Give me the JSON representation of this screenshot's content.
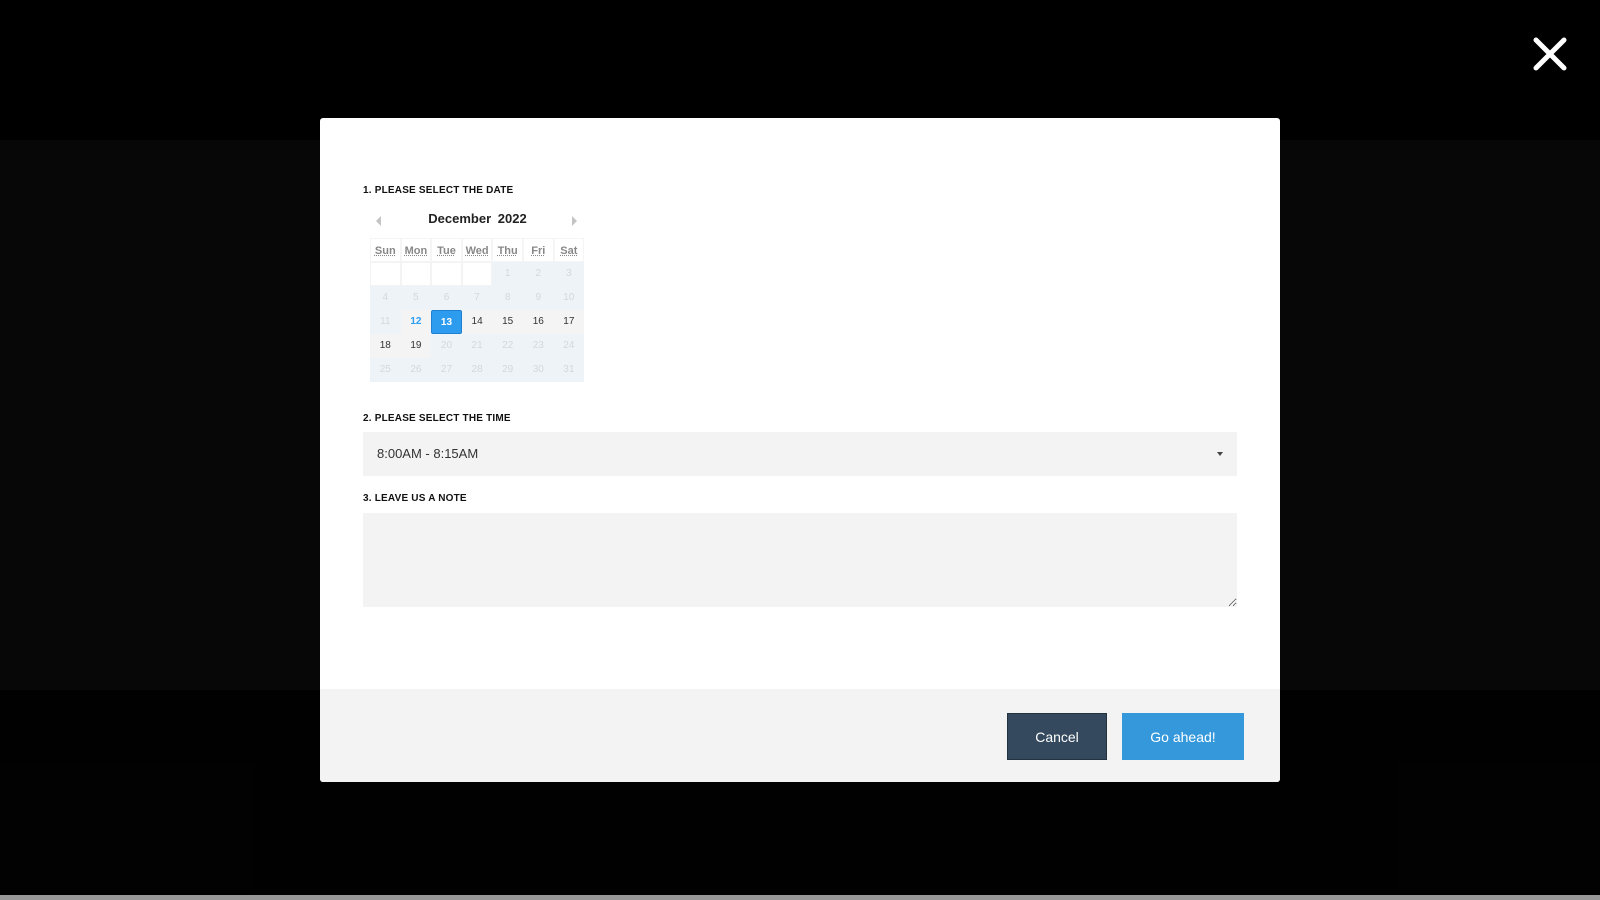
{
  "close": {
    "icon": "close-icon",
    "label": "Close"
  },
  "modal": {
    "date_section": {
      "label": "1. Please select the date",
      "calendar": {
        "month": "December",
        "year": "2022",
        "prev_icon": "chevron-left-icon",
        "next_icon": "chevron-right-icon",
        "weekdays": [
          "Sun",
          "Mon",
          "Tue",
          "Wed",
          "Thu",
          "Fri",
          "Sat"
        ],
        "leading_empty_days": 4,
        "days": [
          {
            "d": "1",
            "state": "disabled"
          },
          {
            "d": "2",
            "state": "disabled"
          },
          {
            "d": "3",
            "state": "disabled"
          },
          {
            "d": "4",
            "state": "disabled"
          },
          {
            "d": "5",
            "state": "disabled"
          },
          {
            "d": "6",
            "state": "disabled"
          },
          {
            "d": "7",
            "state": "disabled"
          },
          {
            "d": "8",
            "state": "disabled"
          },
          {
            "d": "9",
            "state": "disabled"
          },
          {
            "d": "10",
            "state": "disabled"
          },
          {
            "d": "11",
            "state": "disabled"
          },
          {
            "d": "12",
            "state": "today"
          },
          {
            "d": "13",
            "state": "selected"
          },
          {
            "d": "14",
            "state": "available"
          },
          {
            "d": "15",
            "state": "available"
          },
          {
            "d": "16",
            "state": "available"
          },
          {
            "d": "17",
            "state": "available"
          },
          {
            "d": "18",
            "state": "available"
          },
          {
            "d": "19",
            "state": "available"
          },
          {
            "d": "20",
            "state": "disabled"
          },
          {
            "d": "21",
            "state": "disabled"
          },
          {
            "d": "22",
            "state": "disabled"
          },
          {
            "d": "23",
            "state": "disabled"
          },
          {
            "d": "24",
            "state": "disabled"
          },
          {
            "d": "25",
            "state": "disabled"
          },
          {
            "d": "26",
            "state": "disabled"
          },
          {
            "d": "27",
            "state": "disabled"
          },
          {
            "d": "28",
            "state": "disabled"
          },
          {
            "d": "29",
            "state": "disabled"
          },
          {
            "d": "30",
            "state": "disabled"
          },
          {
            "d": "31",
            "state": "disabled"
          }
        ],
        "selected_date": "13",
        "today": "12"
      }
    },
    "time_section": {
      "label": "2. Please select the time",
      "selected": "8:00AM - 8:15AM",
      "arrow_icon": "caret-down-icon"
    },
    "note_section": {
      "label": "3. Leave us a note",
      "value": "",
      "placeholder": ""
    },
    "footer": {
      "cancel_label": "Cancel",
      "confirm_label": "Go ahead!"
    }
  }
}
